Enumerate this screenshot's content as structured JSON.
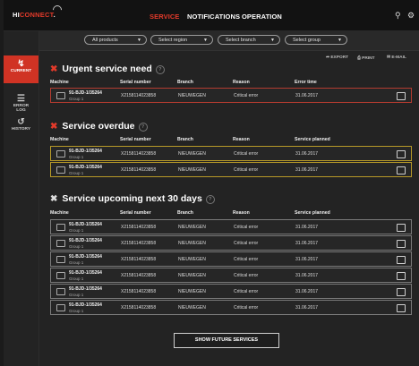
{
  "app": {
    "logo_main": "HI",
    "logo_accent": "CONNECT",
    "logo_suffix": "."
  },
  "nav": {
    "items": [
      {
        "label": "SERVICE"
      },
      {
        "label": "NOTIFICATIONS"
      },
      {
        "label": "OPERATION"
      }
    ]
  },
  "sidebar": {
    "items": [
      {
        "label": "CURRENT",
        "icon": "lightning-icon"
      },
      {
        "label": "ERROR\nLOG",
        "icon": "list-icon"
      },
      {
        "label": "HISTORY",
        "icon": "history-icon"
      }
    ]
  },
  "filters": {
    "products": "All products",
    "region": "Select region",
    "branch": "Select branch",
    "group": "Select group"
  },
  "actions": {
    "export": "EXPORT",
    "print": "PRINT",
    "email": "E-MAIL"
  },
  "columns": {
    "machine": "Machine",
    "serial": "Serial number",
    "branch": "Branch",
    "reason": "Reason",
    "error_time": "Error time",
    "service_planned": "Service planned"
  },
  "sections": {
    "urgent": {
      "title": "Urgent service need",
      "rows": [
        {
          "machine": "91-BJD-1/35264",
          "group": "Group 1",
          "serial": "X2158114023858",
          "branch": "NIEUWEGEN",
          "reason": "Critical error",
          "date": "31.06.2017"
        }
      ]
    },
    "overdue": {
      "title": "Service overdue",
      "rows": [
        {
          "machine": "91-BJD-1/35264",
          "group": "Group 1",
          "serial": "X2158114023858",
          "branch": "NIEUWEGEN",
          "reason": "Critical error",
          "date": "31.06.2017"
        },
        {
          "machine": "91-BJD-1/35264",
          "group": "Group 1",
          "serial": "X2158114023858",
          "branch": "NIEUWEGEN",
          "reason": "Critical error",
          "date": "31.06.2017"
        }
      ]
    },
    "upcoming": {
      "title": "Service upcoming next 30 days",
      "rows": [
        {
          "machine": "91-BJD-1/35264",
          "group": "Group 1",
          "serial": "X2158114023858",
          "branch": "NIEUWEGEN",
          "reason": "Critical error",
          "date": "31.06.2017"
        },
        {
          "machine": "91-BJD-1/35264",
          "group": "Group 1",
          "serial": "X2158114023858",
          "branch": "NIEUWEGEN",
          "reason": "Critical error",
          "date": "31.06.2017"
        },
        {
          "machine": "91-BJD-1/35264",
          "group": "Group 1",
          "serial": "X2158114023858",
          "branch": "NIEUWEGEN",
          "reason": "Critical error",
          "date": "31.06.2017"
        },
        {
          "machine": "91-BJD-1/35264",
          "group": "Group 1",
          "serial": "X2158114023858",
          "branch": "NIEUWEGEN",
          "reason": "Critical error",
          "date": "31.06.2017"
        },
        {
          "machine": "91-BJD-1/35264",
          "group": "Group 1",
          "serial": "X2158114023858",
          "branch": "NIEUWEGEN",
          "reason": "Critical error",
          "date": "31.06.2017"
        },
        {
          "machine": "91-BJD-1/35264",
          "group": "Group 1",
          "serial": "X2158114023858",
          "branch": "NIEUWEGEN",
          "reason": "Critical error",
          "date": "31.06.2017"
        }
      ]
    }
  },
  "buttons": {
    "show_future": "SHOW FUTURE SERVICES"
  },
  "colors": {
    "accent": "#e33a2a",
    "urgent_border": "#b33b30",
    "overdue_border": "#b79a28"
  }
}
